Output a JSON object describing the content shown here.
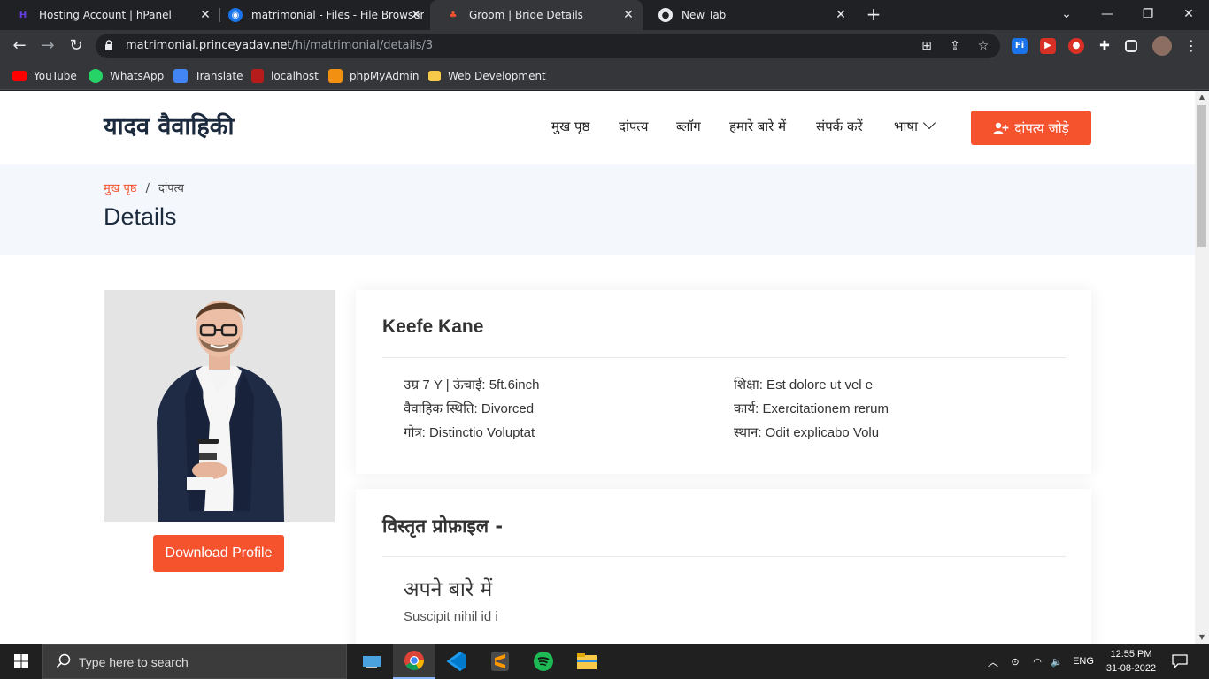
{
  "browser": {
    "tabs": [
      {
        "title": "Hosting Account | hPanel",
        "close": "✕"
      },
      {
        "title": "matrimonial - Files - File Browser",
        "close": "✕"
      },
      {
        "title": "Groom | Bride Details",
        "close": "✕"
      },
      {
        "title": "New Tab",
        "close": "✕"
      }
    ],
    "new_tab": "+",
    "url_host": "matrimonial.princeyadav.net",
    "url_path": "/hi/matrimonial/details/3",
    "bookmarks": [
      "YouTube",
      "WhatsApp",
      "Translate",
      "localhost",
      "phpMyAdmin",
      "Web Development"
    ]
  },
  "site": {
    "logo": "यादव वैवाहिकी",
    "nav": [
      "मुख पृष्ठ",
      "दांपत्य",
      "ब्लॉग",
      "हमारे बारे में",
      "संपर्क करें",
      "भाषा"
    ],
    "cta": "दांपत्य जोड़े"
  },
  "breadcrumb": {
    "home": "मुख पृष्ठ",
    "separator": "/",
    "current": "दांपत्य"
  },
  "page_title": "Details",
  "profile": {
    "name": "Keefe Kane",
    "left_details": [
      "उम्र 7 Y | ऊंचाई: 5ft.6inch",
      "वैवाहिक स्थिति: Divorced",
      "गोत्र: Distinctio Voluptat"
    ],
    "right_details": [
      "शिक्षा: Est dolore ut vel e",
      "कार्य: Exercitationem rerum",
      "स्थान: Odit explicabo Volu"
    ],
    "download_label": "Download Profile"
  },
  "detailed_profile": {
    "title": "विस्तृत प्रोफ़ाइल -",
    "about_heading": "अपने बारे में",
    "about_text": "Suscipit nihil id i"
  },
  "taskbar": {
    "search_placeholder": "Type here to search",
    "language": "ENG",
    "time": "12:55 PM",
    "date": "31-08-2022"
  },
  "colors": {
    "accent": "#f4532e",
    "heading": "#1b2a3d",
    "hero_bg": "#f4f7fc"
  }
}
